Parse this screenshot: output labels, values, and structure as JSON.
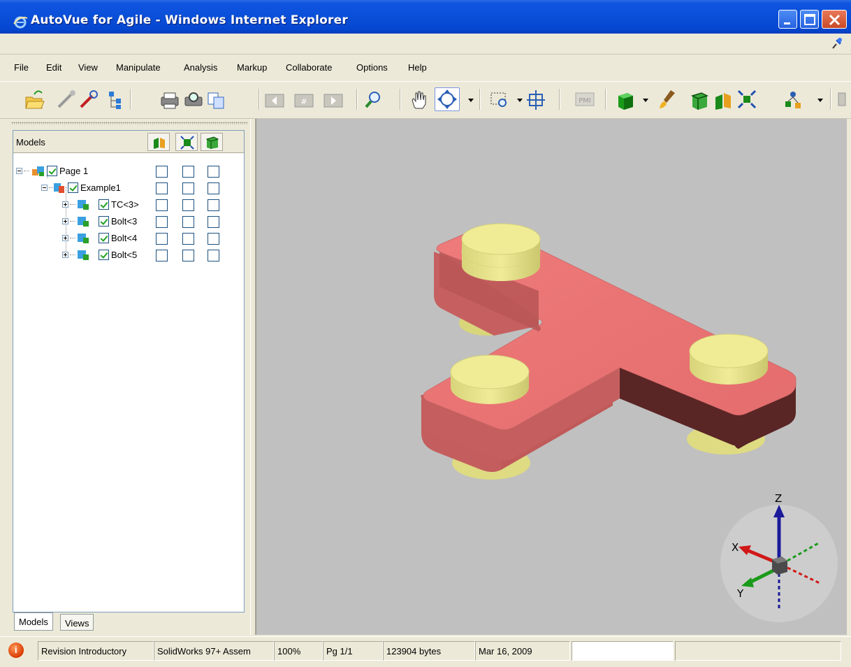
{
  "window": {
    "title": "AutoVue for Agile - Windows Internet Explorer"
  },
  "menu": [
    "File",
    "Edit",
    "View",
    "Manipulate",
    "Analysis",
    "Markup",
    "Collaborate",
    "Options",
    "Help"
  ],
  "toolbar": {
    "buttons": [
      "open-icon",
      "drawing-icon",
      "markup-pen-icon",
      "tree-icon",
      "print-icon",
      "print-preview-icon",
      "copy-icon",
      "prev-page-icon",
      "page-number-icon",
      "next-page-icon",
      "magnifier-icon",
      "pan-hand-icon",
      "rotate-icon",
      "zoom-box-icon",
      "fit-icon",
      "pmi-icon",
      "shaded-cube-icon",
      "paint-brush-icon",
      "wireframe-cube-icon",
      "section-icon",
      "explode-icon",
      "transform-icon"
    ],
    "pmi_label": "PMI"
  },
  "tree": {
    "header": "Models",
    "rows": [
      {
        "label": "Page 1",
        "level": 0,
        "expander": "minus"
      },
      {
        "label": "Example1",
        "level": 1,
        "expander": "minus"
      },
      {
        "label": "TC<3>",
        "level": 2,
        "expander": "plus"
      },
      {
        "label": "Bolt<3",
        "level": 2,
        "expander": "plus"
      },
      {
        "label": "Bolt<4",
        "level": 2,
        "expander": "plus"
      },
      {
        "label": "Bolt<5",
        "level": 2,
        "expander": "plus"
      }
    ]
  },
  "tabs": {
    "models": "Models",
    "views": "Views"
  },
  "axes": {
    "x": "X",
    "y": "Y",
    "z": "Z"
  },
  "status": {
    "revision": "Revision Introductory",
    "format": "SolidWorks 97+ Assem",
    "zoom": "100%",
    "page": "Pg 1/1",
    "size": "123904 bytes",
    "date": "Mar 16, 2009"
  },
  "colors": {
    "model_body": "#e87272",
    "bolt": "#e6e28a",
    "viewport_bg": "#c0c0c0"
  }
}
